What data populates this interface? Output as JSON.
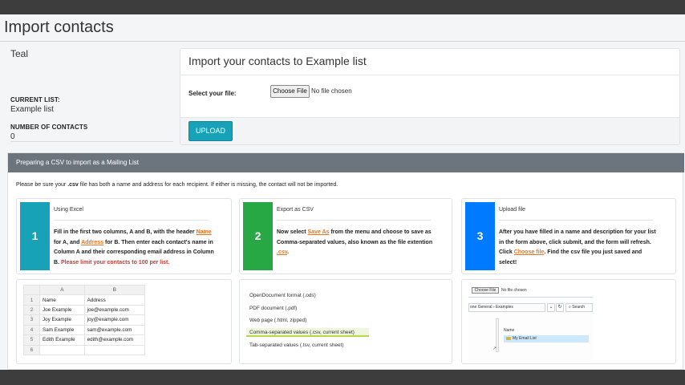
{
  "page": {
    "title": "Import contacts"
  },
  "sidebar": {
    "list_name": "Teal",
    "current_list_label": "CURRENT LIST:",
    "current_list_value": "Example list",
    "contacts_label": "NUMBER OF CONTACTS",
    "contacts_value": "0"
  },
  "import_form": {
    "title": "Import your contacts to Example list",
    "file_label": "Select your file:",
    "choose_button": "Choose File",
    "no_file_text": "No file chosen",
    "upload_button": "UPLOAD"
  },
  "guide": {
    "header": "Preparing a CSV to import as a Mailing List",
    "intro_before": "Please be sure your ",
    "intro_bold": ".csv",
    "intro_after": " file has both a name and address for each recipient. If either is missing, the contact will not be imported.",
    "steps": [
      {
        "number": "1",
        "title": "Using Excel",
        "color": "#17a2b8",
        "t1": "Fill in the first two columns, A and B, with the header ",
        "h1": "Name",
        "t2": " for A, and ",
        "h2": "Address",
        "t3": " for B. Then enter each contact's name in Column A and their corresponding email address in Column B. ",
        "warn": "Please limit your contacts to 100 per list."
      },
      {
        "number": "2",
        "title": "Export as CSV",
        "color": "#28a745",
        "t1": "Now select ",
        "h1": "Save As",
        "t2": " from the menu and choose to save as Comma-separated values, also known as the file extention ",
        "h2": ".csv",
        "t3": "."
      },
      {
        "number": "3",
        "title": "Upload file",
        "color": "#007bff",
        "t1": "After you have filled in a name and description for your list in the form above, click submit, and the form will refresh. Click ",
        "h1": "Choose file",
        "t2": ". Find the csv file you just saved and select!"
      }
    ],
    "sheet": {
      "col_a": "A",
      "col_b": "B",
      "rows": [
        {
          "n": "1",
          "a": "Name",
          "b": "Address"
        },
        {
          "n": "2",
          "a": "Joe Example",
          "b": "joe@example.com"
        },
        {
          "n": "3",
          "a": "Joy Example",
          "b": "joy@example.com"
        },
        {
          "n": "4",
          "a": "Sam Example",
          "b": "sam@example.com"
        },
        {
          "n": "5",
          "a": "Edith Example",
          "b": "edith@example.com"
        },
        {
          "n": "6",
          "a": "",
          "b": ""
        }
      ]
    },
    "formats": [
      "OpenDocument format (.ods)",
      "PDF document (.pdf)",
      "Web page (.html, zipped)",
      "Comma-separated values (.csv, current sheet)",
      "Tab-separated values (.tsv, current sheet)"
    ],
    "dialog": {
      "choose_button": "Choose File",
      "no_file_text": "No file chosen",
      "path": "one General  ›  Examples",
      "search": "Search",
      "column_header": "Name",
      "row_label": "My Email List"
    }
  }
}
